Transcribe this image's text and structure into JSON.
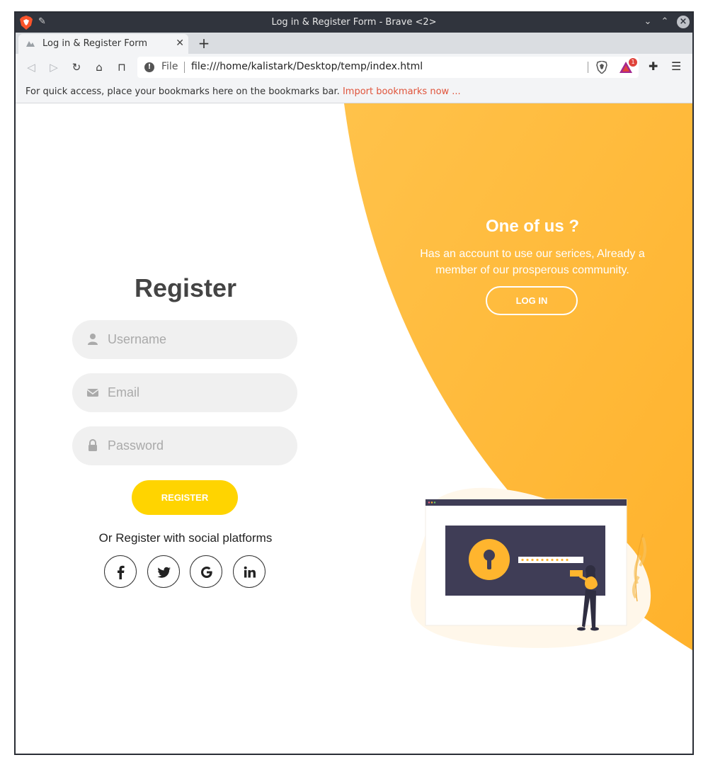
{
  "browser": {
    "window_title": "Log in & Register Form - Brave <2>",
    "tab_title": "Log in & Register Form",
    "url_scheme": "File",
    "url": "file:///home/kalistark/Desktop/temp/index.html",
    "rewards_badge": "1",
    "bookmarks_message": "For quick access, place your bookmarks here on the bookmarks bar.",
    "bookmarks_link": "Import bookmarks now ..."
  },
  "register": {
    "title": "Register",
    "username_placeholder": "Username",
    "email_placeholder": "Email",
    "password_placeholder": "Password",
    "button_label": "REGISTER",
    "social_text": "Or Register with social platforms",
    "socials": [
      "facebook",
      "twitter",
      "google",
      "linkedin"
    ]
  },
  "panel": {
    "title": "One of us ?",
    "text": "Has an account to use our serices, Already a member of our prosperous community.",
    "button_label": "LOG IN"
  },
  "colors": {
    "accent": "#ffb52e",
    "button": "#ffd400",
    "illustration_dark": "#3f3d56"
  }
}
